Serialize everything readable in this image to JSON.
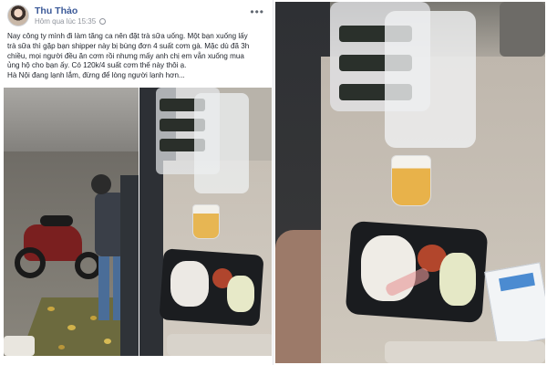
{
  "post": {
    "author": "Thu Thảo",
    "timestamp": "Hôm qua lúc 15:35",
    "more_glyph": "•••",
    "lines": [
      "Nay công ty mình đi làm tăng ca nên đặt trà sữa uống. Một bạn xuống lấy",
      "trà sữa thì gặp bạn shipper này bị bùng đơn 4 suất cơm gà. Mặc dù đã 3h",
      "chiều, mọi người đều ăn cơm rồi nhưng mấy anh chị em vẫn xuống mua",
      "ủng hộ cho bạn ấy. Có 120k/4 suất cơm thế này thôi ạ.",
      "Hà Nội đang lạnh lắm, đừng để lòng người lạnh hơn..."
    ]
  },
  "photos": [
    {
      "name": "shipper-motorbike-photo"
    },
    {
      "name": "rice-box-and-tea-photo"
    },
    {
      "name": "rice-box-closeup-photo"
    }
  ],
  "colors": {
    "fb_blue": "#3b5998",
    "text": "#1d2129",
    "meta": "#90949c"
  }
}
